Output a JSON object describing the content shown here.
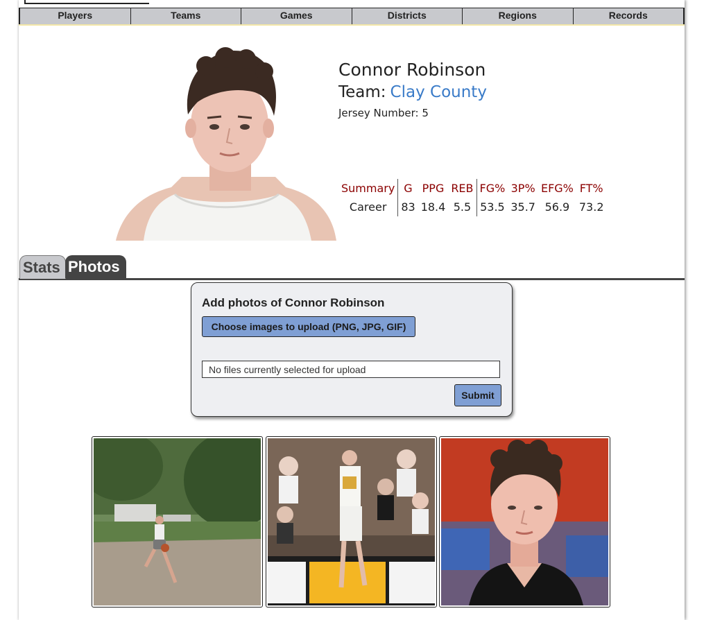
{
  "nav": {
    "items": [
      {
        "label": "Players"
      },
      {
        "label": "Teams"
      },
      {
        "label": "Games"
      },
      {
        "label": "Districts"
      },
      {
        "label": "Regions"
      },
      {
        "label": "Records"
      }
    ]
  },
  "player": {
    "name": "Connor Robinson",
    "team_prefix": "Team:",
    "team": "Clay County",
    "jersey": "Jersey Number: 5",
    "headshot_icon": "player-headshot-image"
  },
  "summary": {
    "headers": [
      "Summary",
      "G",
      "PPG",
      "REB",
      "FG%",
      "3P%",
      "EFG%",
      "FT%"
    ],
    "row": [
      "Career",
      "83",
      "18.4",
      "5.5",
      "53.5",
      "35.7",
      "56.9",
      "73.2"
    ]
  },
  "tabs": {
    "stats": "Stats",
    "photos": "Photos",
    "active": "Photos"
  },
  "upload": {
    "title": "Add photos of Connor Robinson",
    "choose_label": "Choose images to upload (PNG, JPG, GIF)",
    "file_status": "No files currently selected for upload",
    "submit_label": "Submit"
  },
  "photos": [
    {
      "icon": "outdoor-court-photo"
    },
    {
      "icon": "game-action-photo"
    },
    {
      "icon": "portrait-photo"
    }
  ],
  "colors": {
    "nav_bg": "#c8c9cd",
    "link": "#3a7bc8",
    "stat_header": "#8b0000",
    "button": "#7f9fd4",
    "tab_active": "#444444"
  }
}
